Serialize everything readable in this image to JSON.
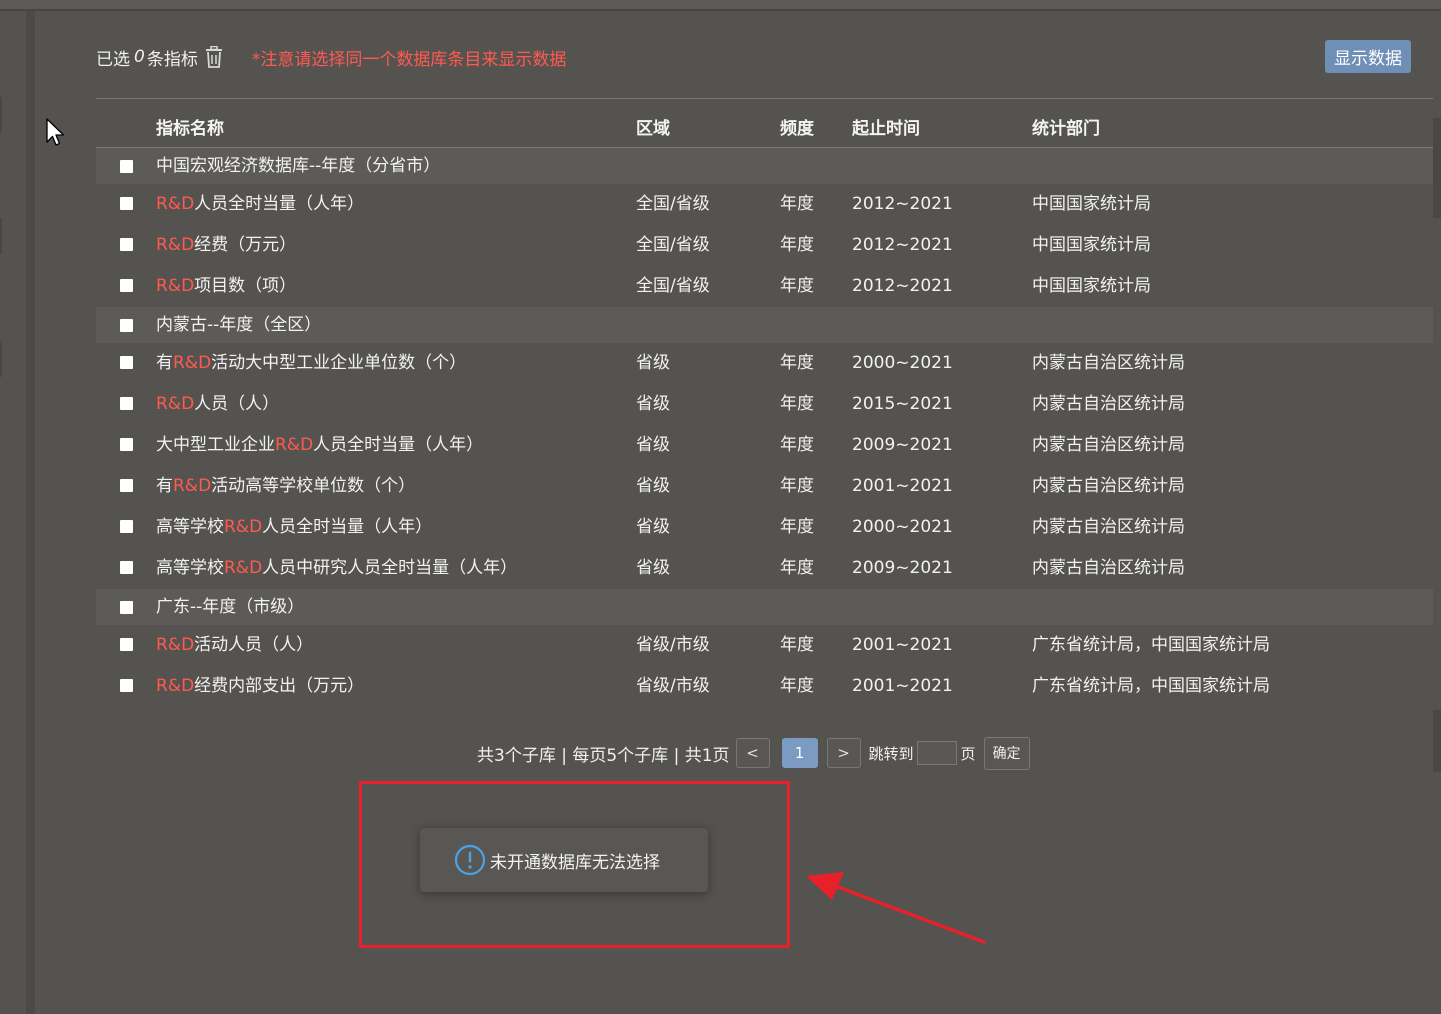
{
  "header": {
    "selected_prefix": "已选",
    "selected_count": "0",
    "selected_suffix": "条指标",
    "notice": "*注意请选择同一个数据库条目来显示数据",
    "show_data_button": "显示数据"
  },
  "table": {
    "columns": {
      "name": "指标名称",
      "area": "区域",
      "freq": "频度",
      "time": "起止时间",
      "dept": "统计部门"
    },
    "groups": [
      {
        "title": "中国宏观经济数据库--年度（分省市）",
        "rows": [
          {
            "pre": "",
            "hl": "R&D",
            "post": "人员全时当量（人年）",
            "area": "全国/省级",
            "freq": "年度",
            "time": "2012~2021",
            "dept": "中国国家统计局"
          },
          {
            "pre": "",
            "hl": "R&D",
            "post": "经费（万元）",
            "area": "全国/省级",
            "freq": "年度",
            "time": "2012~2021",
            "dept": "中国国家统计局"
          },
          {
            "pre": "",
            "hl": "R&D",
            "post": "项目数（项）",
            "area": "全国/省级",
            "freq": "年度",
            "time": "2012~2021",
            "dept": "中国国家统计局"
          }
        ]
      },
      {
        "title": "内蒙古--年度（全区）",
        "rows": [
          {
            "pre": "有",
            "hl": "R&D",
            "post": "活动大中型工业企业单位数（个）",
            "area": "省级",
            "freq": "年度",
            "time": "2000~2021",
            "dept": "内蒙古自治区统计局"
          },
          {
            "pre": "",
            "hl": "R&D",
            "post": "人员（人）",
            "area": "省级",
            "freq": "年度",
            "time": "2015~2021",
            "dept": "内蒙古自治区统计局"
          },
          {
            "pre": "大中型工业企业",
            "hl": "R&D",
            "post": "人员全时当量（人年）",
            "area": "省级",
            "freq": "年度",
            "time": "2009~2021",
            "dept": "内蒙古自治区统计局"
          },
          {
            "pre": "有",
            "hl": "R&D",
            "post": "活动高等学校单位数（个）",
            "area": "省级",
            "freq": "年度",
            "time": "2001~2021",
            "dept": "内蒙古自治区统计局"
          },
          {
            "pre": "高等学校",
            "hl": "R&D",
            "post": "人员全时当量（人年）",
            "area": "省级",
            "freq": "年度",
            "time": "2000~2021",
            "dept": "内蒙古自治区统计局"
          },
          {
            "pre": "高等学校",
            "hl": "R&D",
            "post": "人员中研究人员全时当量（人年）",
            "area": "省级",
            "freq": "年度",
            "time": "2009~2021",
            "dept": "内蒙古自治区统计局"
          }
        ]
      },
      {
        "title": "广东--年度（市级）",
        "rows": [
          {
            "pre": "",
            "hl": "R&D",
            "post": "活动人员（人）",
            "area": "省级/市级",
            "freq": "年度",
            "time": "2001~2021",
            "dept": "广东省统计局，中国国家统计局"
          },
          {
            "pre": "",
            "hl": "R&D",
            "post": "经费内部支出（万元）",
            "area": "省级/市级",
            "freq": "年度",
            "time": "2001~2021",
            "dept": "广东省统计局，中国国家统计局"
          }
        ]
      }
    ]
  },
  "pagination": {
    "summary": "共3个子库 | 每页5个子库 | 共1页",
    "prev": "<",
    "current_page": "1",
    "next": ">",
    "jump_label": "跳转到",
    "jump_value": "",
    "page_unit": "页",
    "confirm": "确定"
  },
  "toast": {
    "icon": "info-circle-icon",
    "message": "未开通数据库无法选择"
  },
  "colors": {
    "background": "#55534f",
    "highlight": "#ff5a50",
    "primary_button": "#6f8fb7",
    "annotation_red": "#e8202a"
  }
}
